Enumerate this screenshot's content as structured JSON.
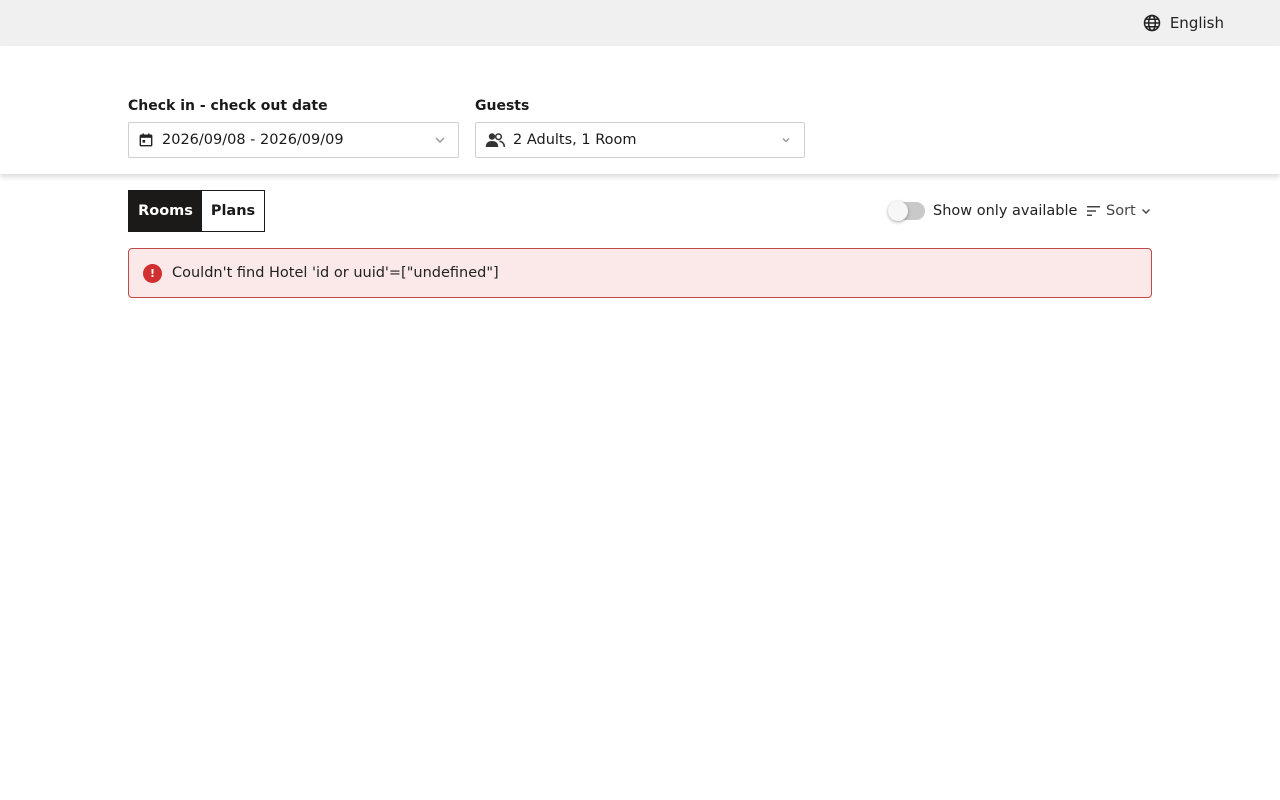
{
  "header": {
    "language_label": "English",
    "language_icon": "globe-icon"
  },
  "search": {
    "date_label": "Check in - check out date",
    "date_value": "2026/09/08 - 2026/09/09",
    "guests_label": "Guests",
    "guests_value": "2 Adults, 1 Room"
  },
  "tabs": [
    {
      "label": "Rooms",
      "active": true
    },
    {
      "label": "Plans",
      "active": false
    }
  ],
  "filters": {
    "show_only_available_label": "Show only available",
    "show_only_available_on": false,
    "sort_label": "Sort"
  },
  "alert": {
    "icon_glyph": "!",
    "message": "Couldn't find Hotel 'id or uuid'=[\"undefined\"]"
  },
  "colors": {
    "tab_active_bg": "#1c1a19",
    "alert_bg": "#fbe9e9",
    "alert_border": "#c04a4a",
    "alert_icon": "#d03030",
    "topbar_bg": "#f0f0f0"
  }
}
